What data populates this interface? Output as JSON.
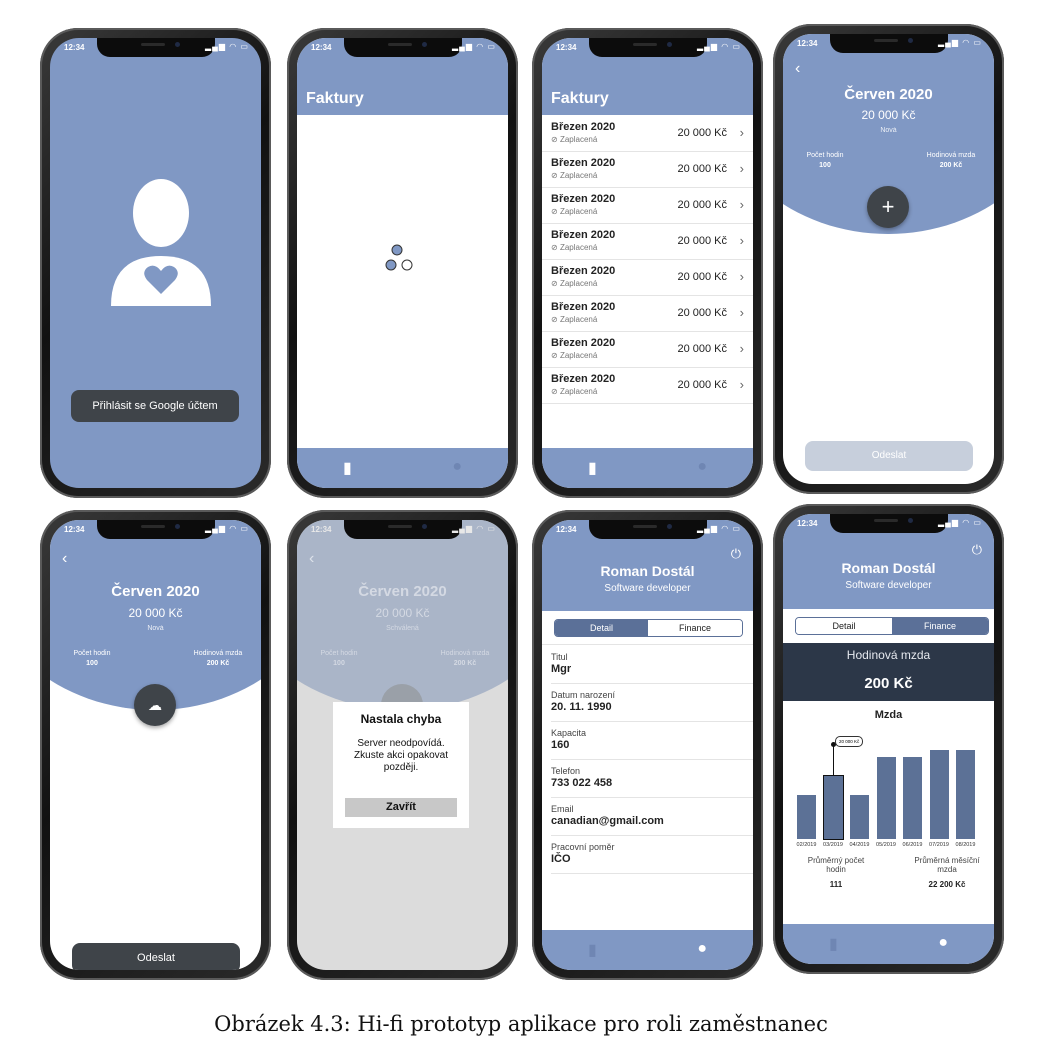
{
  "status": {
    "time": "12:34"
  },
  "login": {
    "button": "Přihlásit se Google účtem"
  },
  "invoices": {
    "title": "Faktury",
    "rows": [
      {
        "month": "Březen 2020",
        "status": "Zaplacená",
        "amount": "20 000 Kč"
      },
      {
        "month": "Březen 2020",
        "status": "Zaplacená",
        "amount": "20 000 Kč"
      },
      {
        "month": "Březen 2020",
        "status": "Zaplacená",
        "amount": "20 000 Kč"
      },
      {
        "month": "Březen 2020",
        "status": "Zaplacená",
        "amount": "20 000 Kč"
      },
      {
        "month": "Březen 2020",
        "status": "Zaplacená",
        "amount": "20 000 Kč"
      },
      {
        "month": "Březen 2020",
        "status": "Zaplacená",
        "amount": "20 000 Kč"
      },
      {
        "month": "Březen 2020",
        "status": "Zaplacená",
        "amount": "20 000 Kč"
      },
      {
        "month": "Březen 2020",
        "status": "Zaplacená",
        "amount": "20 000 Kč"
      }
    ]
  },
  "detail": {
    "month": "Červen 2020",
    "amount": "20 000 Kč",
    "state_new": "Nová",
    "state_approved": "Schválená",
    "hours_label": "Počet hodin",
    "hours": "100",
    "rate_label": "Hodinová mzda",
    "rate": "200 Kč",
    "send": "Odeslat"
  },
  "error": {
    "title": "Nastala chyba",
    "message": "Server neodpovídá. Zkuste akci opakovat později.",
    "close": "Zavřít"
  },
  "profile": {
    "name": "Roman Dostál",
    "role": "Software developer",
    "tab_detail": "Detail",
    "tab_finance": "Finance",
    "fields": [
      {
        "label": "Titul",
        "value": "Mgr"
      },
      {
        "label": "Datum narození",
        "value": "20. 11. 1990"
      },
      {
        "label": "Kapacita",
        "value": "160"
      },
      {
        "label": "Telefon",
        "value": "733 022 458"
      },
      {
        "label": "Email",
        "value": "canadian@gmail.com"
      },
      {
        "label": "Pracovní poměr",
        "value": "IČO"
      }
    ]
  },
  "finance": {
    "rate_label": "Hodinová mzda",
    "rate_value": "200 Kč",
    "chart_title": "Mzda",
    "avg_hours_label": "Průměrný počet hodin",
    "avg_hours": "111",
    "avg_wage_label": "Průměrná měsíční mzda",
    "avg_wage": "22 200 Kč"
  },
  "chart_data": {
    "type": "bar",
    "title": "Mzda",
    "categories": [
      "02/2019",
      "03/2019",
      "04/2019",
      "05/2019",
      "06/2019",
      "07/2019",
      "08/2019"
    ],
    "values": [
      14000,
      20000,
      14000,
      26000,
      26000,
      28000,
      28000
    ],
    "ylim": [
      0,
      30000
    ],
    "annotation": {
      "category": "03/2019",
      "label": "20 000 Kč"
    },
    "grid": false
  },
  "caption": "Obrázek 4.3: Hi-fi prototyp aplikace pro roli zaměstnanec"
}
